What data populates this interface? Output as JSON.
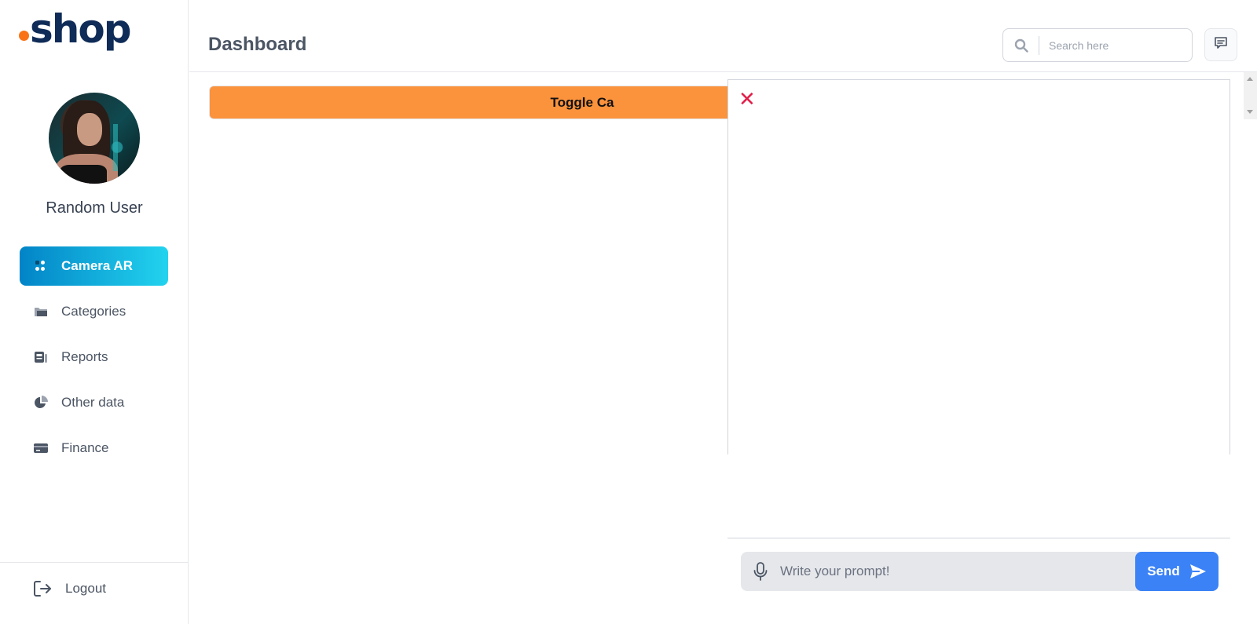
{
  "sidebar": {
    "logo": ".shop",
    "logo_word": "shop",
    "user_name": "Random User",
    "items": [
      {
        "label": "Camera AR",
        "icon": "dots-grid-icon",
        "active": true
      },
      {
        "label": "Categories",
        "icon": "folder-icon",
        "active": false
      },
      {
        "label": "Reports",
        "icon": "newspaper-icon",
        "active": false
      },
      {
        "label": "Other data",
        "icon": "pie-chart-icon",
        "active": false
      },
      {
        "label": "Finance",
        "icon": "credit-card-icon",
        "active": false
      }
    ],
    "logout_label": "Logout"
  },
  "header": {
    "title": "Dashboard",
    "search_placeholder": "Search here"
  },
  "main": {
    "toggle_label": "Toggle Ca"
  },
  "chat": {
    "close_symbol": "✕",
    "prompt_placeholder": "Write your prompt!",
    "send_label": "Send"
  },
  "colors": {
    "brand_dark": "#0f2b57",
    "brand_dot": "#f97316",
    "active_gradient_start": "#0284c7",
    "active_gradient_end": "#22d3ee",
    "toggle_bar": "#fb923c",
    "send_button": "#3b82f6",
    "close_icon": "#e11d48"
  }
}
